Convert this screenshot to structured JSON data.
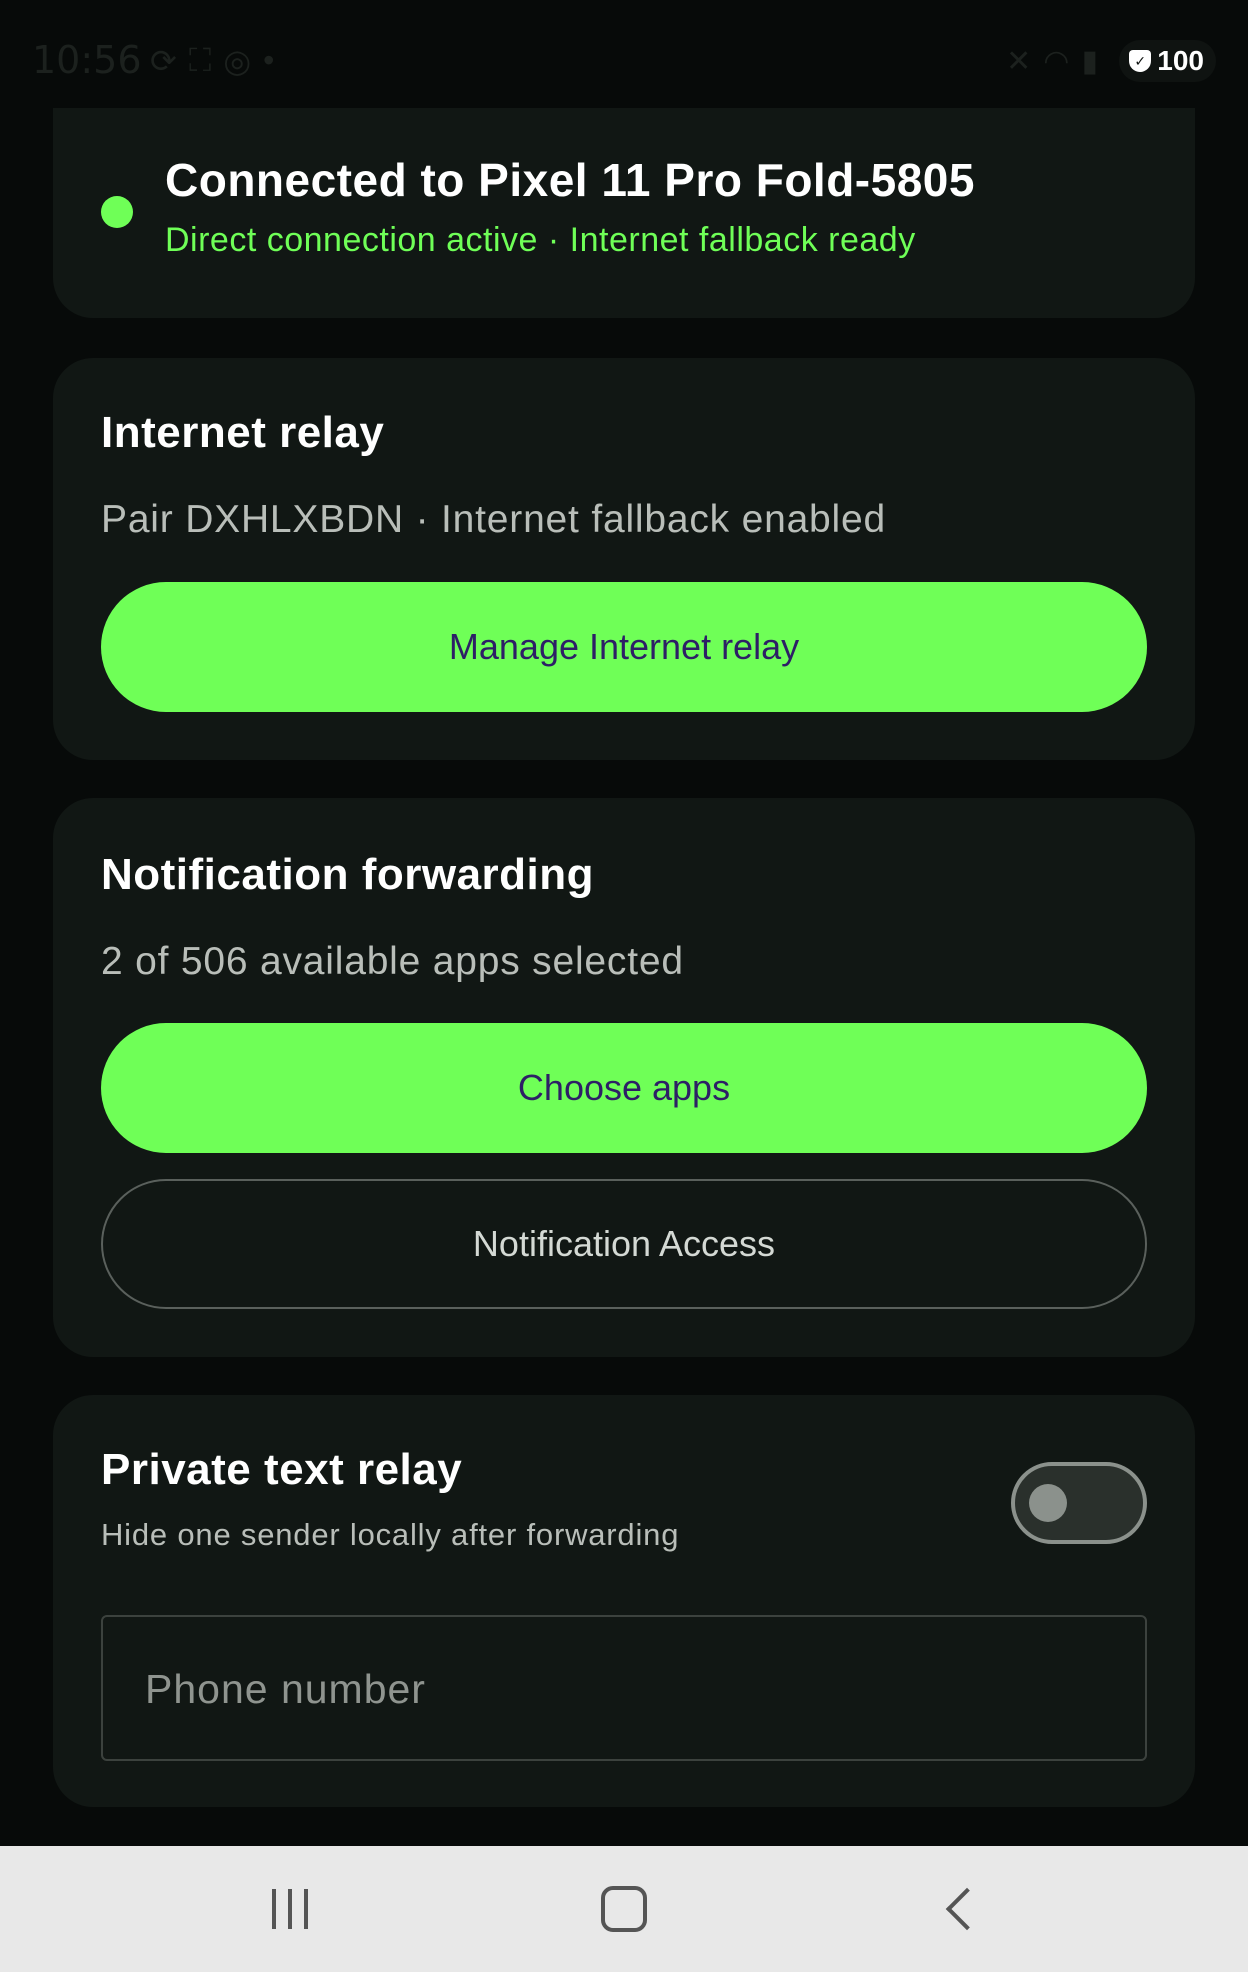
{
  "status_bar": {
    "time": "10:56",
    "battery": "100"
  },
  "connection": {
    "title": "Connected to Pixel 11 Pro Fold-5805",
    "subtitle": "Direct connection active · Internet fallback ready"
  },
  "internet_relay": {
    "title": "Internet relay",
    "status": "Pair DXHLXBDN · Internet fallback enabled",
    "manage_button": "Manage Internet relay"
  },
  "notification_forwarding": {
    "title": "Notification forwarding",
    "status": "2 of 506 available apps selected",
    "choose_button": "Choose apps",
    "access_button": "Notification Access"
  },
  "private_text_relay": {
    "title": "Private text relay",
    "subtitle": "Hide one sender locally after forwarding",
    "enabled": false,
    "phone_placeholder": "Phone number",
    "phone_value": ""
  },
  "colors": {
    "accent": "#6fff57",
    "background": "#070a09",
    "card": "#111714",
    "button_text": "#2d1f66"
  },
  "icons": {
    "status_left": [
      "sync-icon",
      "screenshot-icon",
      "location-icon",
      "dot-icon"
    ],
    "status_right": [
      "mute-icon",
      "wifi-icon",
      "signal-icon",
      "shield-icon"
    ],
    "nav": [
      "recents-icon",
      "home-icon",
      "back-icon"
    ]
  }
}
